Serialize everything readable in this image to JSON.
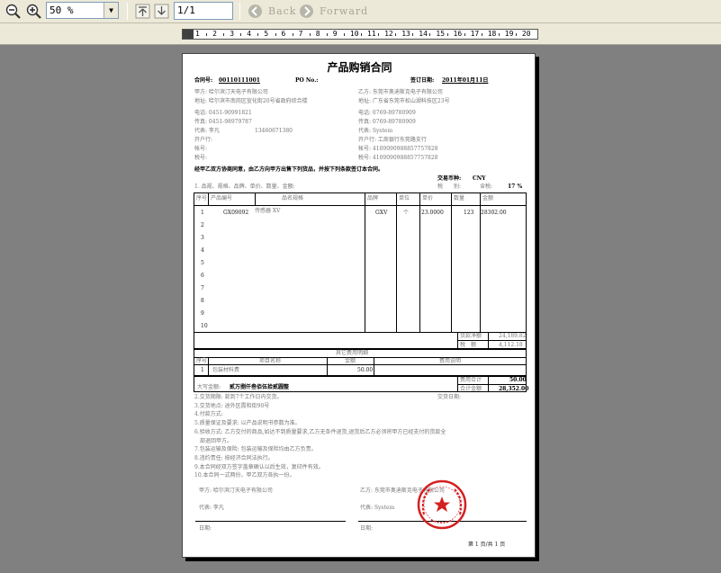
{
  "toolbar": {
    "zoom_value": "50 %",
    "page_value": "1/1",
    "back_label": "Back",
    "forward_label": "Forward"
  },
  "ruler": {
    "numbers": [
      "1",
      "2",
      "3",
      "4",
      "5",
      "6",
      "7",
      "8",
      "9",
      "10",
      "11",
      "12",
      "13",
      "14",
      "15",
      "16",
      "17",
      "18",
      "19",
      "20"
    ]
  },
  "doc": {
    "title": "产品购销合同",
    "contract_no_label": "合同号:",
    "contract_no": "00110111001",
    "po_label": "PO No.:",
    "sign_date_label": "签订日期:",
    "sign_date": "2011年01月11日",
    "party_a": {
      "name": "甲方: 哈尔滨汀天电子有限公司",
      "address": "地址: 哈尔滨市南岗区宣化街20号省政府综合楼",
      "phone": "电话: 0451-90991821",
      "fax": "传真: 0451-98979787",
      "rep_label": "代表: 李凡",
      "mobile": "13460671380",
      "bank": "开户行:",
      "account": "帐号:",
      "tax": "税号:"
    },
    "party_b": {
      "name": "乙方: 东莞市奥迪斯克电子有限公司",
      "address": "地址: 广东省东莞市松山湖科技区23号",
      "phone": "电话: 0769-89780909",
      "fax": "传真: 0769-89780909",
      "rep": "代表: System",
      "bank": "开户行: 工商银行东莞路支行",
      "account": "帐号: 4109090988857757828",
      "tax": "税号: 4109090988857757828"
    },
    "intro": "经甲乙双方协商同意，由乙方向甲方出售下列货品，并按下列条款签订本合同。",
    "section1": "1. 品规、规格、品牌、单价、数量、金额:",
    "currency_label": "交易币种:",
    "currency": "CNY",
    "tax_label": "税　　别:",
    "tax_rate_label": "含税:",
    "tax_rate": "17 %",
    "columns": [
      "序号",
      "产品编号",
      "品名规格",
      "品牌",
      "单位",
      "单价",
      "数量",
      "金额"
    ],
    "rows": [
      {
        "no": "1",
        "code": "GX09092",
        "name": "传感器 XV",
        "brand": "GXV",
        "unit": "个",
        "price": "23.0000",
        "qty": "123",
        "amount": "28302.00"
      },
      {
        "no": "2"
      },
      {
        "no": "3"
      },
      {
        "no": "4"
      },
      {
        "no": "5"
      },
      {
        "no": "6"
      },
      {
        "no": "7"
      },
      {
        "no": "8"
      },
      {
        "no": "9"
      },
      {
        "no": "10"
      }
    ],
    "subtotal_label": "货款净额",
    "subtotal": "24,189.82",
    "tax_amount_label": "税　额",
    "tax_amount": "4,112.18",
    "extra_title": "其它费用明细",
    "extra_columns": [
      "序号",
      "项目名称",
      "金额",
      "费用说明"
    ],
    "extra_row": {
      "no": "1",
      "name": "包装材料费",
      "amount": "50.00"
    },
    "fee_total_label": "费用合计",
    "fee_total": "50.00",
    "grand_total_label": "合计金额",
    "grand_total": "28,352.00",
    "capital_label": "大写金额:",
    "capital": "贰万捌仟叁佰伍拾贰圆整",
    "delivery_date_label": "交货日期:",
    "terms": [
      "2.交货期限: 款到7个工作日内交货。",
      "3.交货地点: 途外区霞和街90号",
      "4.付款方式:",
      "5.质量保证及要求: 以产品说明书参数为准。",
      "6.验收方式: 乙方交付的商品,如达不到质量要求,乙方无条件退货,退货后乙方必须将甲方已经支付的货款全",
      "　部退回甲方。",
      "7.包装运输及保险: 包装运输及保险均由乙方负责。",
      "8.违约责任: 按经济合同法执行。",
      "9.本合同经双方签字盖章确认以后生效，复印件有效。",
      "10.本合同一式两份，甲乙双方各执一份。"
    ],
    "sign_a": "甲方: 哈尔滨汀天电子有限公司",
    "sign_b": "乙方: 东莞市奥迪斯克电子有限公司",
    "sign_rep_a": "代表: 李凡",
    "sign_rep_b": "代表: System",
    "sign_date_a": "日期:",
    "sign_date_b": "日期:",
    "page_footer": "第 1 页/共 1 页"
  },
  "colors": {
    "toolbar_bg": "#ece9d8",
    "workspace_bg": "#808080",
    "stamp_red": "#d42020"
  }
}
